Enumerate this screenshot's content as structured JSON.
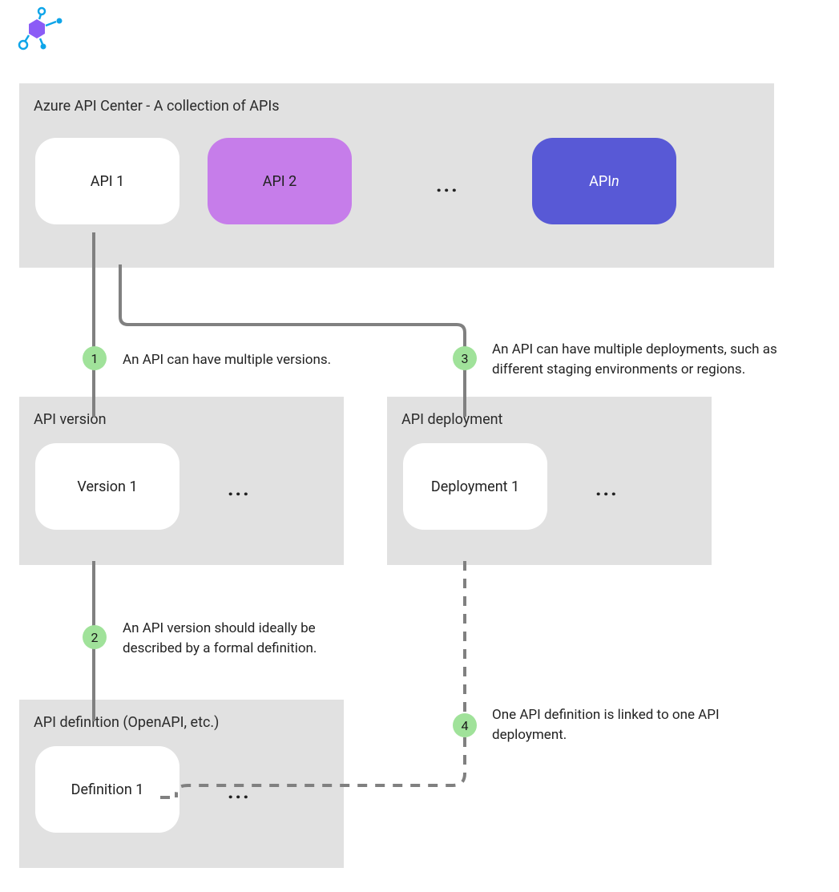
{
  "panels": {
    "main": {
      "title": "Azure API Center - A collection of APIs"
    },
    "version": {
      "title": "API version"
    },
    "deployment": {
      "title": "API deployment"
    },
    "definition": {
      "title": "API definition (OpenAPI, etc.)"
    }
  },
  "nodes": {
    "api1": "API 1",
    "api2": "API 2",
    "apin_prefix": "API ",
    "apin_suffix": "n",
    "version1": "Version 1",
    "deployment1": "Deployment 1",
    "definition1": "Definition 1"
  },
  "ellipsis": "...",
  "annotations": {
    "a1": {
      "num": "1",
      "text": "An API can have multiple versions."
    },
    "a2": {
      "num": "2",
      "text": "An API version should ideally be described by a formal definition."
    },
    "a3": {
      "num": "3",
      "text": "An API can have multiple deployments, such as different staging environments or regions."
    },
    "a4": {
      "num": "4",
      "text": "One API definition is linked to one API deployment."
    }
  },
  "colors": {
    "panel_bg": "#e1e1e1",
    "node_white": "#ffffff",
    "node_purple": "#c67dea",
    "node_indigo": "#5859d6",
    "badge": "#a0e29a",
    "line": "#808080"
  }
}
